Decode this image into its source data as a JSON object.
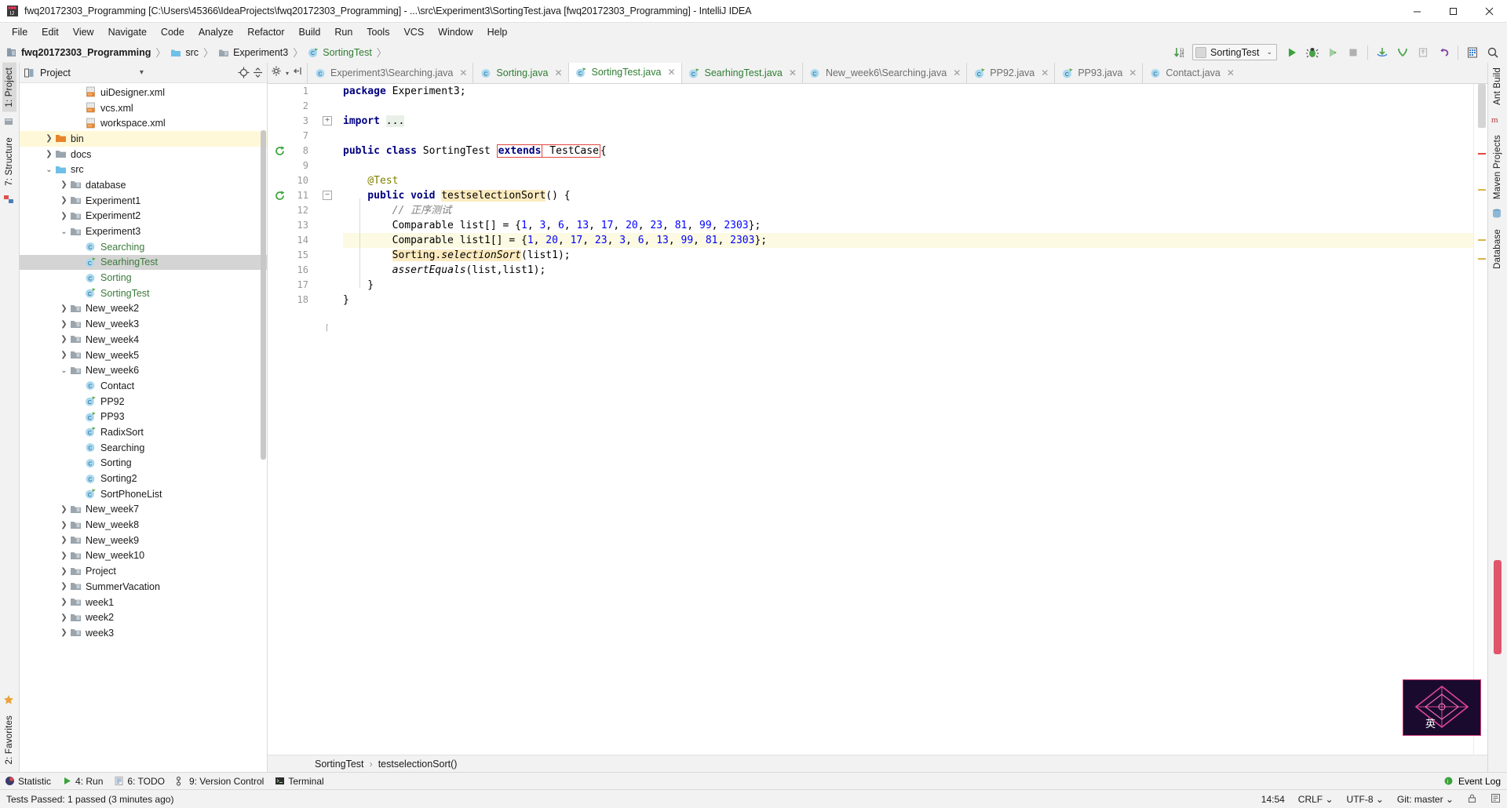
{
  "window": {
    "title": "fwq20172303_Programming [C:\\Users\\45366\\IdeaProjects\\fwq20172303_Programming] - ...\\src\\Experiment3\\SortingTest.java [fwq20172303_Programming] - IntelliJ IDEA",
    "minimize": "–",
    "maximize": "❐",
    "close": "✕"
  },
  "menubar": {
    "items": [
      {
        "label": "File"
      },
      {
        "label": "Edit"
      },
      {
        "label": "View"
      },
      {
        "label": "Navigate"
      },
      {
        "label": "Code"
      },
      {
        "label": "Analyze"
      },
      {
        "label": "Refactor"
      },
      {
        "label": "Build"
      },
      {
        "label": "Run"
      },
      {
        "label": "Tools"
      },
      {
        "label": "VCS"
      },
      {
        "label": "Window"
      },
      {
        "label": "Help"
      }
    ]
  },
  "navbar": {
    "breadcrumbs": [
      {
        "label": "fwq20172303_Programming",
        "icon": "project-icon"
      },
      {
        "label": "src",
        "icon": "source-folder-icon"
      },
      {
        "label": "Experiment3",
        "icon": "folder-icon"
      },
      {
        "label": "SortingTest",
        "icon": "java-class-test-icon"
      }
    ],
    "separator": "〉",
    "run_config": "SortingTest",
    "run_config_arrow": "⌄",
    "buttons": [
      {
        "name": "sort-binary-icon"
      },
      {
        "name": "run-icon"
      },
      {
        "name": "debug-icon"
      },
      {
        "name": "run-coverage-icon"
      },
      {
        "name": "stop-icon"
      },
      {
        "name": "update-project-icon"
      },
      {
        "name": "commit-icon"
      },
      {
        "name": "push-icon"
      },
      {
        "name": "undo-icon"
      },
      {
        "name": "project-structure-icon"
      },
      {
        "name": "search-everywhere-icon"
      }
    ]
  },
  "left_rail": {
    "tabs": [
      {
        "label": "1: Project",
        "active": true
      },
      {
        "label": "7: Structure",
        "active": false
      }
    ],
    "bottom_label": "2: Favorites"
  },
  "project_panel": {
    "title": "Project",
    "dropdown_arrow": "▾",
    "tree": [
      {
        "label": "uiDesigner.xml",
        "depth": 3,
        "icon": "xml-file-icon",
        "arrow": "",
        "state": "normal",
        "color": "dark"
      },
      {
        "label": "vcs.xml",
        "depth": 3,
        "icon": "xml-file-icon",
        "arrow": "",
        "state": "normal",
        "color": "dark"
      },
      {
        "label": "workspace.xml",
        "depth": 3,
        "icon": "xml-file-icon",
        "arrow": "",
        "state": "normal",
        "color": "dark"
      },
      {
        "label": "bin",
        "depth": 1,
        "icon": "folder-orange-icon",
        "arrow": "❯",
        "state": "highlight",
        "color": "dark"
      },
      {
        "label": "docs",
        "depth": 1,
        "icon": "folder-icon",
        "arrow": "❯",
        "state": "normal",
        "color": "dark"
      },
      {
        "label": "src",
        "depth": 1,
        "icon": "source-folder-icon",
        "arrow": "⌄",
        "state": "normal",
        "color": "dark"
      },
      {
        "label": "database",
        "depth": 2,
        "icon": "package-icon",
        "arrow": "❯",
        "state": "normal",
        "color": "dark"
      },
      {
        "label": "Experiment1",
        "depth": 2,
        "icon": "package-icon",
        "arrow": "❯",
        "state": "normal",
        "color": "dark"
      },
      {
        "label": "Experiment2",
        "depth": 2,
        "icon": "package-icon",
        "arrow": "❯",
        "state": "normal",
        "color": "dark"
      },
      {
        "label": "Experiment3",
        "depth": 2,
        "icon": "package-icon",
        "arrow": "⌄",
        "state": "normal",
        "color": "dark"
      },
      {
        "label": "Searching",
        "depth": 3,
        "icon": "java-class-icon",
        "arrow": "",
        "state": "normal",
        "color": "green"
      },
      {
        "label": "SearhingTest",
        "depth": 3,
        "icon": "java-class-test-icon",
        "arrow": "",
        "state": "selected",
        "color": "green"
      },
      {
        "label": "Sorting",
        "depth": 3,
        "icon": "java-class-icon",
        "arrow": "",
        "state": "normal",
        "color": "green"
      },
      {
        "label": "SortingTest",
        "depth": 3,
        "icon": "java-class-test-icon",
        "arrow": "",
        "state": "normal",
        "color": "green"
      },
      {
        "label": "New_week2",
        "depth": 2,
        "icon": "package-icon",
        "arrow": "❯",
        "state": "normal",
        "color": "dark"
      },
      {
        "label": "New_week3",
        "depth": 2,
        "icon": "package-icon",
        "arrow": "❯",
        "state": "normal",
        "color": "dark"
      },
      {
        "label": "New_week4",
        "depth": 2,
        "icon": "package-icon",
        "arrow": "❯",
        "state": "normal",
        "color": "dark"
      },
      {
        "label": "New_week5",
        "depth": 2,
        "icon": "package-icon",
        "arrow": "❯",
        "state": "normal",
        "color": "dark"
      },
      {
        "label": "New_week6",
        "depth": 2,
        "icon": "package-icon",
        "arrow": "⌄",
        "state": "normal",
        "color": "dark"
      },
      {
        "label": "Contact",
        "depth": 3,
        "icon": "java-class-icon",
        "arrow": "",
        "state": "normal",
        "color": "dark"
      },
      {
        "label": "PP92",
        "depth": 3,
        "icon": "java-class-test-icon",
        "arrow": "",
        "state": "normal",
        "color": "dark"
      },
      {
        "label": "PP93",
        "depth": 3,
        "icon": "java-class-test-icon",
        "arrow": "",
        "state": "normal",
        "color": "dark"
      },
      {
        "label": "RadixSort",
        "depth": 3,
        "icon": "java-class-test-icon",
        "arrow": "",
        "state": "normal",
        "color": "dark"
      },
      {
        "label": "Searching",
        "depth": 3,
        "icon": "java-class-icon",
        "arrow": "",
        "state": "normal",
        "color": "dark"
      },
      {
        "label": "Sorting",
        "depth": 3,
        "icon": "java-class-icon",
        "arrow": "",
        "state": "normal",
        "color": "dark"
      },
      {
        "label": "Sorting2",
        "depth": 3,
        "icon": "java-class-icon",
        "arrow": "",
        "state": "normal",
        "color": "dark"
      },
      {
        "label": "SortPhoneList",
        "depth": 3,
        "icon": "java-class-test-icon",
        "arrow": "",
        "state": "normal",
        "color": "dark"
      },
      {
        "label": "New_week7",
        "depth": 2,
        "icon": "package-icon",
        "arrow": "❯",
        "state": "normal",
        "color": "dark"
      },
      {
        "label": "New_week8",
        "depth": 2,
        "icon": "package-icon",
        "arrow": "❯",
        "state": "normal",
        "color": "dark"
      },
      {
        "label": "New_week9",
        "depth": 2,
        "icon": "package-icon",
        "arrow": "❯",
        "state": "normal",
        "color": "dark"
      },
      {
        "label": "New_week10",
        "depth": 2,
        "icon": "package-icon",
        "arrow": "❯",
        "state": "normal",
        "color": "dark"
      },
      {
        "label": "Project",
        "depth": 2,
        "icon": "package-icon",
        "arrow": "❯",
        "state": "normal",
        "color": "dark"
      },
      {
        "label": "SummerVacation",
        "depth": 2,
        "icon": "package-icon",
        "arrow": "❯",
        "state": "normal",
        "color": "dark"
      },
      {
        "label": "week1",
        "depth": 2,
        "icon": "package-icon",
        "arrow": "❯",
        "state": "normal",
        "color": "dark"
      },
      {
        "label": "week2",
        "depth": 2,
        "icon": "package-icon",
        "arrow": "❯",
        "state": "normal",
        "color": "dark"
      },
      {
        "label": "week3",
        "depth": 2,
        "icon": "package-icon",
        "arrow": "❯",
        "state": "normal",
        "color": "dark"
      }
    ]
  },
  "editor_tabs": [
    {
      "label": "Experiment3\\Searching.java",
      "icon": "java-class-icon",
      "active": false,
      "color": "grey"
    },
    {
      "label": "Sorting.java",
      "icon": "java-class-icon",
      "active": false,
      "color": "green"
    },
    {
      "label": "SortingTest.java",
      "icon": "java-class-test-icon",
      "active": true,
      "color": "green"
    },
    {
      "label": "SearhingTest.java",
      "icon": "java-class-test-icon",
      "active": false,
      "color": "green"
    },
    {
      "label": "New_week6\\Searching.java",
      "icon": "java-class-icon",
      "active": false,
      "color": "grey"
    },
    {
      "label": "PP92.java",
      "icon": "java-class-test-icon",
      "active": false,
      "color": "grey"
    },
    {
      "label": "PP93.java",
      "icon": "java-class-test-icon",
      "active": false,
      "color": "grey"
    },
    {
      "label": "Contact.java",
      "icon": "java-class-icon",
      "active": false,
      "color": "grey"
    }
  ],
  "editor_tab_close": "✕",
  "code": {
    "line_numbers": [
      "1",
      "2",
      "3",
      "7",
      "8",
      "9",
      "10",
      "11",
      "12",
      "13",
      "14",
      "15",
      "16",
      "17",
      "18"
    ],
    "lines": [
      {
        "n": "1",
        "segments": [
          {
            "t": "package ",
            "c": "kw"
          },
          {
            "t": "Experiment3;",
            "c": "plain"
          }
        ]
      },
      {
        "n": "2",
        "segments": []
      },
      {
        "n": "3",
        "segments": [
          {
            "t": "import ",
            "c": "kw"
          },
          {
            "t": "...",
            "c": "folded"
          }
        ]
      },
      {
        "n": "7",
        "segments": []
      },
      {
        "n": "8",
        "segments": [
          {
            "t": "public class ",
            "c": "kw"
          },
          {
            "t": "SortingTest ",
            "c": "plain"
          },
          {
            "t": "extends",
            "c": "kw-box"
          },
          {
            "t": " TestCase",
            "c": "plain-box"
          },
          {
            "t": "{",
            "c": "plain"
          }
        ]
      },
      {
        "n": "9",
        "segments": []
      },
      {
        "n": "10",
        "segments": [
          {
            "t": "    @Test",
            "c": "ann"
          }
        ]
      },
      {
        "n": "11",
        "segments": [
          {
            "t": "    public void ",
            "c": "kw"
          },
          {
            "t": "testselectionSort",
            "c": "hl"
          },
          {
            "t": "() {",
            "c": "plain"
          }
        ]
      },
      {
        "n": "12",
        "segments": [
          {
            "t": "        // 正序测试",
            "c": "cmt"
          }
        ]
      },
      {
        "n": "13",
        "segments": [
          {
            "t": "        Comparable list[] = {",
            "c": "plain"
          },
          {
            "t": "1",
            "c": "num"
          },
          {
            "t": ", ",
            "c": "plain"
          },
          {
            "t": "3",
            "c": "num"
          },
          {
            "t": ", ",
            "c": "plain"
          },
          {
            "t": "6",
            "c": "num"
          },
          {
            "t": ", ",
            "c": "plain"
          },
          {
            "t": "13",
            "c": "num"
          },
          {
            "t": ", ",
            "c": "plain"
          },
          {
            "t": "17",
            "c": "num"
          },
          {
            "t": ", ",
            "c": "plain"
          },
          {
            "t": "20",
            "c": "num"
          },
          {
            "t": ", ",
            "c": "plain"
          },
          {
            "t": "23",
            "c": "num"
          },
          {
            "t": ", ",
            "c": "plain"
          },
          {
            "t": "81",
            "c": "num"
          },
          {
            "t": ", ",
            "c": "plain"
          },
          {
            "t": "99",
            "c": "num"
          },
          {
            "t": ", ",
            "c": "plain"
          },
          {
            "t": "2303",
            "c": "num"
          },
          {
            "t": "};",
            "c": "plain"
          }
        ]
      },
      {
        "n": "14",
        "segments": [
          {
            "t": "        Comparable list1[] = {",
            "c": "plain"
          },
          {
            "t": "1",
            "c": "num"
          },
          {
            "t": ", ",
            "c": "plain"
          },
          {
            "t": "20",
            "c": "num"
          },
          {
            "t": ", ",
            "c": "plain"
          },
          {
            "t": "17",
            "c": "num"
          },
          {
            "t": ", ",
            "c": "plain"
          },
          {
            "t": "23",
            "c": "num"
          },
          {
            "t": ", ",
            "c": "plain"
          },
          {
            "t": "3",
            "c": "num"
          },
          {
            "t": ", ",
            "c": "plain"
          },
          {
            "t": "6",
            "c": "num"
          },
          {
            "t": ", ",
            "c": "plain"
          },
          {
            "t": "13",
            "c": "num"
          },
          {
            "t": ", ",
            "c": "plain"
          },
          {
            "t": "99",
            "c": "num"
          },
          {
            "t": ", ",
            "c": "plain"
          },
          {
            "t": "81",
            "c": "num"
          },
          {
            "t": ", ",
            "c": "plain"
          },
          {
            "t": "2303",
            "c": "num"
          },
          {
            "t": "};",
            "c": "plain"
          }
        ]
      },
      {
        "n": "15",
        "segments": [
          {
            "t": "        ",
            "c": "plain"
          },
          {
            "t": "Sorting.",
            "c": "hl"
          },
          {
            "t": "selectionSort",
            "c": "hl-ital"
          },
          {
            "t": "(list1);",
            "c": "plain"
          }
        ]
      },
      {
        "n": "16",
        "segments": [
          {
            "t": "        ",
            "c": "plain"
          },
          {
            "t": "assertEquals",
            "c": "ital"
          },
          {
            "t": "(list,list1);",
            "c": "plain"
          }
        ]
      },
      {
        "n": "17",
        "segments": [
          {
            "t": "    }",
            "c": "plain"
          }
        ]
      },
      {
        "n": "18",
        "segments": [
          {
            "t": "}",
            "c": "plain"
          }
        ]
      }
    ],
    "gutter_icons": [
      {
        "line_index": 4,
        "name": "run-class-gutter-icon"
      },
      {
        "line_index": 7,
        "name": "run-method-gutter-icon"
      },
      {
        "line_index": 10,
        "name": "intention-bulb-icon"
      }
    ],
    "fold_markers": [
      {
        "line_index": 2,
        "glyph": "+"
      },
      {
        "line_index": 7,
        "glyph": "−"
      },
      {
        "line_index": 16,
        "glyph": "⌈"
      }
    ],
    "highlighted_line_index": 10
  },
  "editor_breadcrumb": {
    "items": [
      "SortingTest",
      "testselectionSort()"
    ],
    "separator": "›"
  },
  "right_rail": {
    "tabs": [
      "Ant Build",
      "Maven Projects",
      "Database"
    ]
  },
  "toolwindow_bar": {
    "items": [
      {
        "label": "Statistic",
        "icon": "statistic-icon"
      },
      {
        "label": "4: Run",
        "icon": "run-icon"
      },
      {
        "label": "6: TODO",
        "icon": "todo-icon"
      },
      {
        "label": "9: Version Control",
        "icon": "vcs-icon"
      },
      {
        "label": "Terminal",
        "icon": "terminal-icon"
      }
    ],
    "right_label": "Event Log",
    "right_icon": "event-log-icon"
  },
  "statusbar": {
    "message": "Tests Passed: 1 passed (3 minutes ago)",
    "time": "14:54",
    "line_sep": "CRLF ⌄",
    "encoding": "UTF-8 ⌄",
    "branch": "Git: master ⌄",
    "lock_icon": "lock-icon",
    "inspect_icon": "inspection-icon"
  },
  "widget": {
    "label": "英",
    "name": "ime-indicator"
  },
  "colors": {
    "accent_green": "#2f7d32",
    "keyword_blue": "#000080",
    "number_blue": "#0000ff",
    "error_red": "#e2473f",
    "highlight_yellow": "#fcebc0",
    "selection_grey": "#d4d4d4"
  }
}
